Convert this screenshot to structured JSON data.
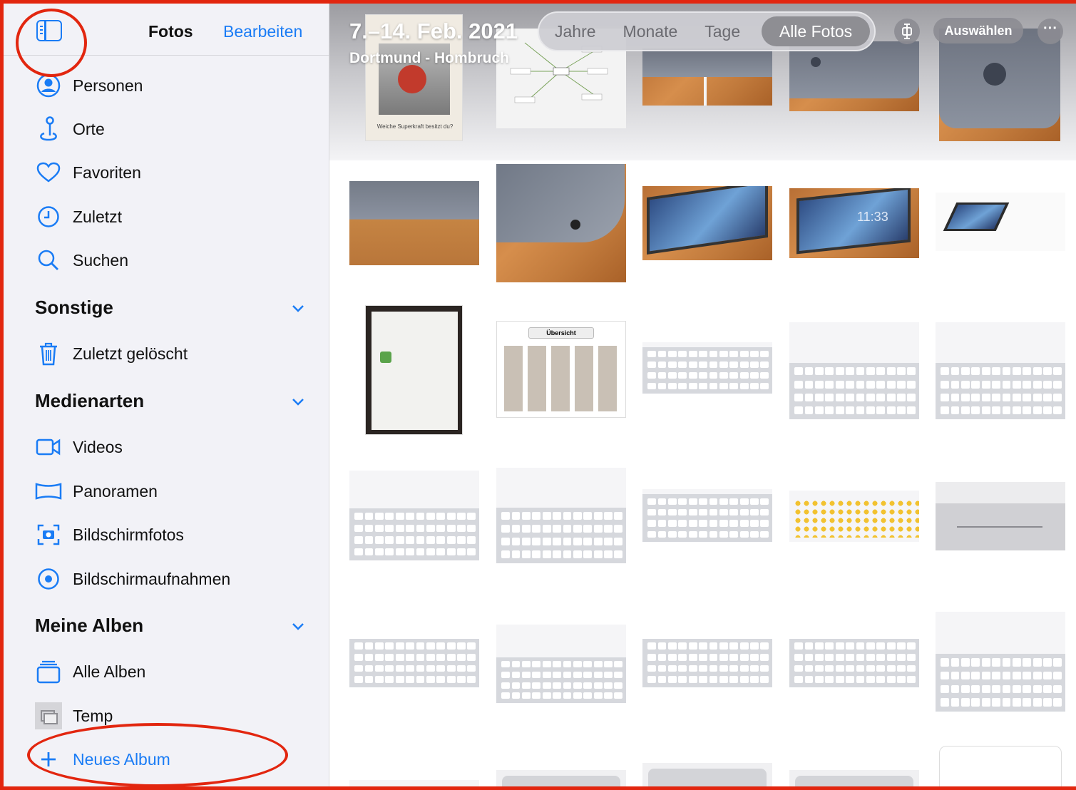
{
  "sidebar": {
    "title": "Fotos",
    "edit_label": "Bearbeiten",
    "items_top": [
      {
        "label": "Personen",
        "icon": "person-circle-icon"
      },
      {
        "label": "Orte",
        "icon": "map-pin-icon"
      },
      {
        "label": "Favoriten",
        "icon": "heart-icon"
      },
      {
        "label": "Zuletzt",
        "icon": "clock-icon"
      },
      {
        "label": "Suchen",
        "icon": "search-icon"
      }
    ],
    "section_other": "Sonstige",
    "item_deleted": "Zuletzt gelöscht",
    "section_media": "Medienarten",
    "media_items": [
      {
        "label": "Videos",
        "icon": "video-icon"
      },
      {
        "label": "Panoramen",
        "icon": "panorama-icon"
      },
      {
        "label": "Bildschirmfotos",
        "icon": "screenshot-icon"
      },
      {
        "label": "Bildschirmaufnahmen",
        "icon": "screen-recording-icon"
      }
    ],
    "section_albums": "Meine Alben",
    "album_items": [
      {
        "label": "Alle Alben",
        "icon": "albums-stack-icon"
      },
      {
        "label": "Temp",
        "icon": "album-thumbnail-icon"
      }
    ],
    "new_album_label": "Neues Album"
  },
  "main": {
    "date_title": "7.–14. Feb. 2021",
    "location": "Dortmund - Hombruch",
    "segments": [
      "Jahre",
      "Monate",
      "Tage"
    ],
    "segment_active": "Alle Fotos",
    "select_label": "Auswählen",
    "thumb_top_doc_text": "Weiche Superkraft besitzt du?",
    "thumb_overview_title": "Übersicht",
    "ipad_clock": "11:33"
  },
  "colors": {
    "accent": "#1a7cf5",
    "annotation": "#e2260f",
    "sidebar_bg": "#f2f2f7"
  }
}
